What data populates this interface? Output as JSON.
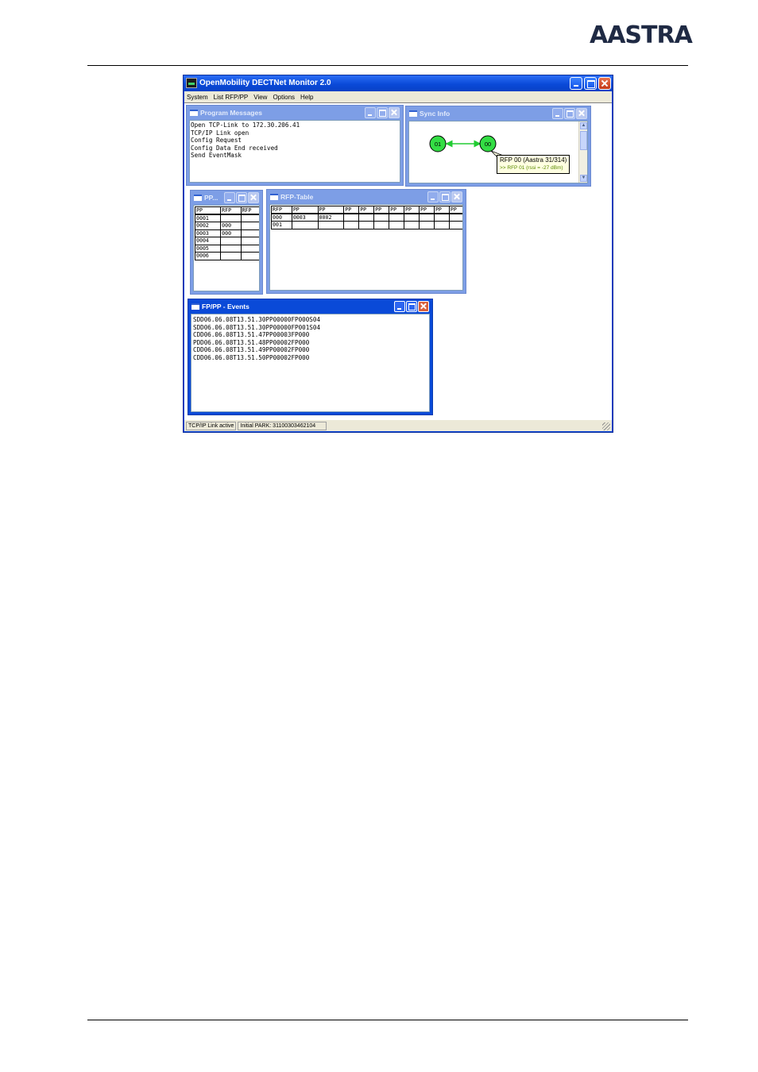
{
  "header": {
    "logo_text": "AASTRA"
  },
  "window": {
    "title": "OpenMobility DECTNet Monitor 2.0",
    "menu": [
      "System",
      "List RFP/PP",
      "View",
      "Options",
      "Help"
    ],
    "status": [
      "TCP/IP Link active",
      "Initial PARK: 31100303462104"
    ]
  },
  "program_messages": {
    "title": "Program Messages",
    "lines": [
      "Open TCP-Link to 172.30.206.41",
      "TCP/IP Link open",
      "Config Request",
      "Config Data End received",
      "Send EventMask"
    ]
  },
  "sync_info": {
    "title": "Sync Info",
    "nodes": [
      "01",
      "00"
    ],
    "tooltip_title": "RFP 00 (Aastra 31/314)",
    "tooltip_detail": ">> RFP 01 (rssi = -27 dBm)",
    "node_color": "#33dd44",
    "link_color": "#22cc33"
  },
  "pp_window": {
    "title": "PP...",
    "headers": [
      "PP",
      "RFP",
      "RFP"
    ],
    "rows": [
      [
        "0001",
        "",
        ""
      ],
      [
        "0002",
        "000",
        ""
      ],
      [
        "0003",
        "000",
        ""
      ],
      [
        "0004",
        "",
        ""
      ],
      [
        "0005",
        "",
        ""
      ],
      [
        "0006",
        "",
        ""
      ]
    ]
  },
  "rfp_table": {
    "title": "RFP-Table",
    "headers": [
      "RFP",
      "PP",
      "PP",
      "PP",
      "PP",
      "PP",
      "PP",
      "PP",
      "PP",
      "PP",
      "PP"
    ],
    "rows": [
      [
        "000",
        "0003",
        "0002",
        "",
        "",
        "",
        "",
        "",
        "",
        "",
        ""
      ],
      [
        "001",
        "",
        "",
        "",
        "",
        "",
        "",
        "",
        "",
        "",
        ""
      ]
    ]
  },
  "events": {
    "title": "FP/PP - Events",
    "lines": [
      "SDD06.06.08T13.51.30PP00000FP000S04",
      "SDD06.06.08T13.51.30PP00000FP001S04",
      "CDD06.06.08T13.51.47PP00003FP000",
      "PDD06.06.08T13.51.48PP00002FP000",
      "CDD06.06.08T13.51.49PP00002FP000",
      "CDD06.06.08T13.51.50PP00002FP000"
    ]
  }
}
